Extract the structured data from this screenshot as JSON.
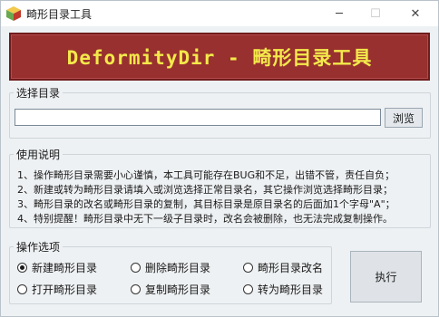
{
  "window": {
    "title": "畸形目录工具",
    "controls": {
      "minimize": "─",
      "maximize": "☐",
      "close": "✕"
    },
    "app_icon": "cube-icon"
  },
  "banner": {
    "text": "DeformityDir - 畸形目录工具",
    "bg_color": "#98302f",
    "text_color": "#f3e94a"
  },
  "dir_group": {
    "legend": "选择目录",
    "input_value": "",
    "browse_label": "浏览"
  },
  "usage": {
    "legend": "使用说明",
    "lines": [
      "1、操作畸形目录需要小心谨慎，本工具可能存在BUG和不足，出错不管，责任自负；",
      "2、新建或转为畸形目录请填入或浏览选择正常目录名，其它操作浏览选择畸形目录；",
      "3、畸形目录的改名或畸形目录的复制，其目标目录是原目录名的后面加1个字母\"A\"；",
      "4、特别提醒！畸形目录中无下一级子目录时，改名会被删除，也无法完成复制操作。"
    ]
  },
  "ops": {
    "legend": "操作选项",
    "options": [
      {
        "label": "新建畸形目录",
        "checked": true
      },
      {
        "label": "删除畸形目录",
        "checked": false
      },
      {
        "label": "畸形目录改名",
        "checked": false
      },
      {
        "label": "打开畸形目录",
        "checked": false
      },
      {
        "label": "复制畸形目录",
        "checked": false
      },
      {
        "label": "转为畸形目录",
        "checked": false
      }
    ],
    "execute_label": "执行"
  }
}
